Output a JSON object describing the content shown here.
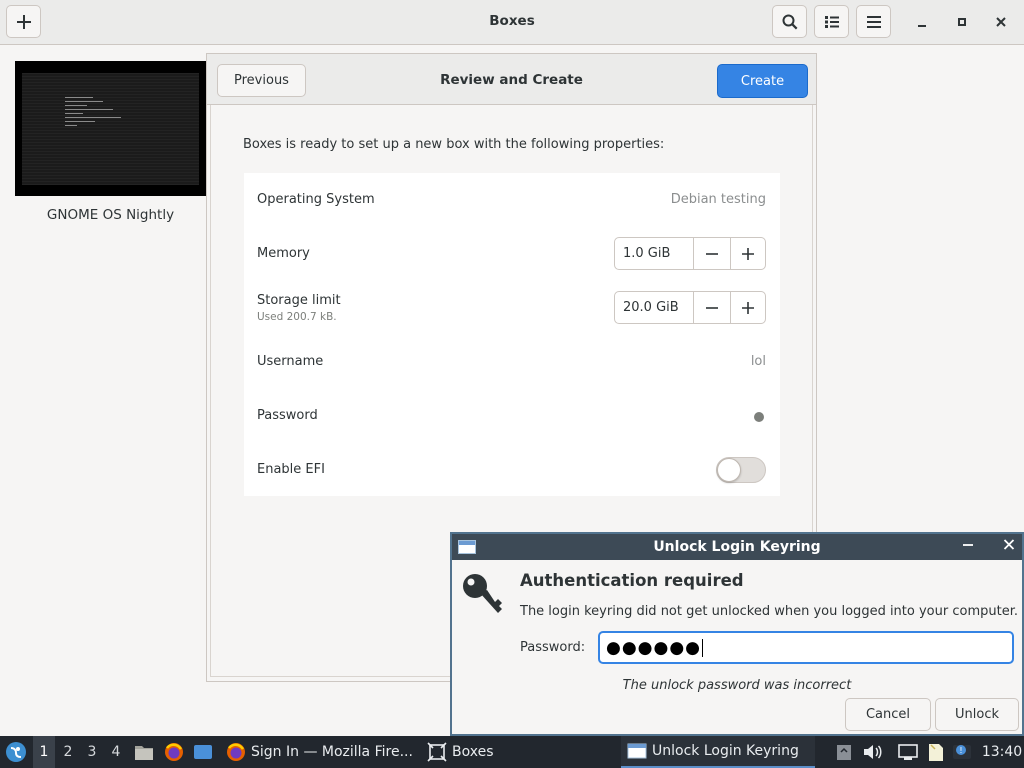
{
  "app": {
    "title": "Boxes"
  },
  "library": {
    "items": [
      {
        "name": "GNOME OS Nightly"
      }
    ]
  },
  "assistant": {
    "previous_label": "Previous",
    "title": "Review and Create",
    "create_label": "Create",
    "intro": "Boxes is ready to set up a new box with the following properties:",
    "properties": {
      "os": {
        "label": "Operating System",
        "value": "Debian testing"
      },
      "memory": {
        "label": "Memory",
        "value": "1.0 GiB"
      },
      "storage": {
        "label": "Storage limit",
        "sublabel": "Used 200.7 kB.",
        "value": "20.0 GiB"
      },
      "username": {
        "label": "Username",
        "value": "lol"
      },
      "password": {
        "label": "Password"
      },
      "efi": {
        "label": "Enable EFI",
        "enabled": false
      }
    }
  },
  "keyring_dialog": {
    "title": "Unlock Login Keyring",
    "heading": "Authentication required",
    "message": "The login keyring did not get unlocked when you logged into your computer.",
    "password_label": "Password:",
    "password_masked": "●●●●●●",
    "error": "The unlock password was incorrect",
    "cancel_label": "Cancel",
    "unlock_label": "Unlock"
  },
  "taskbar": {
    "workspaces": [
      "1",
      "2",
      "3",
      "4"
    ],
    "active_workspace": "1",
    "tasks": [
      {
        "label": "Sign In — Mozilla Fire...",
        "icon": "firefox-icon"
      },
      {
        "label": "Boxes",
        "icon": "boxes-icon"
      },
      {
        "label": "Unlock Login Keyring",
        "icon": "window-icon"
      }
    ],
    "clock": "13:40"
  },
  "colors": {
    "accent": "#3584e4",
    "taskbar_bg": "#22272e",
    "dialog_titlebar": "#3d4a56"
  }
}
